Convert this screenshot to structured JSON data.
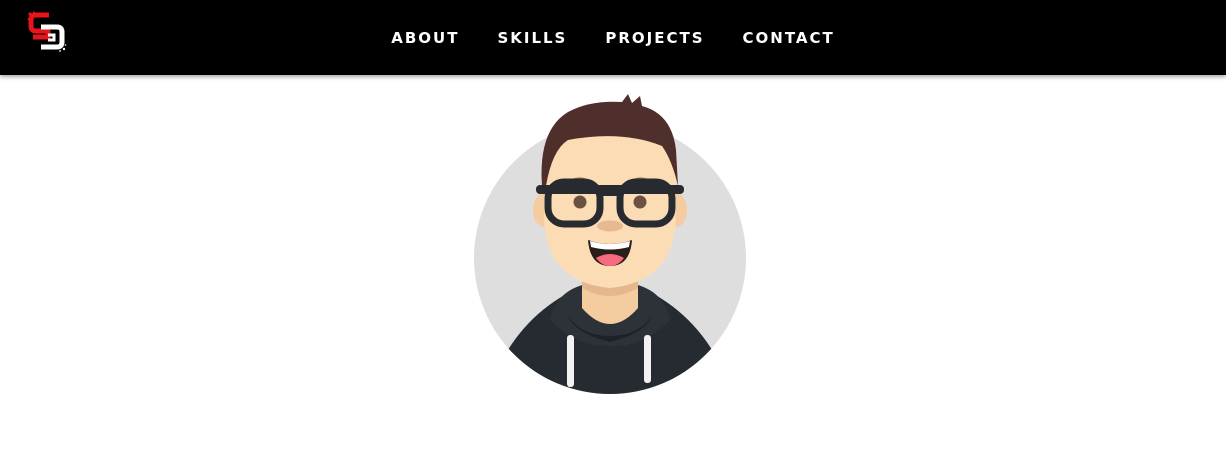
{
  "header": {
    "logo_icon": "sd-monogram-logo-icon",
    "nav": [
      {
        "label": "ABOUT"
      },
      {
        "label": "SKILLS"
      },
      {
        "label": "PROJECTS"
      },
      {
        "label": "CONTACT"
      }
    ]
  },
  "hero": {
    "avatar_icon": "cartoon-developer-avatar"
  },
  "colors": {
    "navbar_bg": "#000000",
    "nav_text": "#ffffff",
    "logo_red": "#e8141b",
    "avatar_circle": "#dedede",
    "hoodie": "#262b31",
    "skin": "#fcdcb4",
    "hair": "#4e2f2b"
  }
}
